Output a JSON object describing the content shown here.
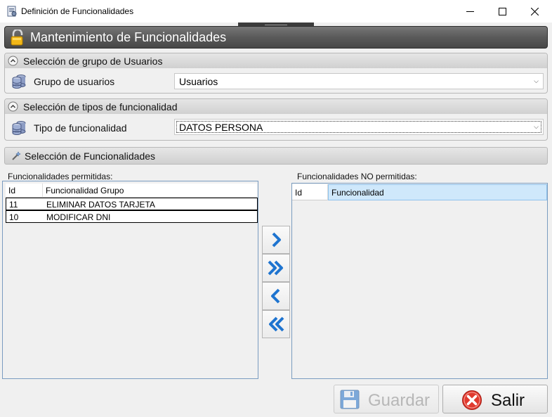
{
  "window": {
    "title": "Definición de Funcionalidades",
    "icon": "app-form-icon"
  },
  "header": {
    "title": "Mantenimiento de Funcionalidades",
    "icon": "lock-icon"
  },
  "group_users": {
    "title": "Selección de grupo de Usuarios",
    "label": "Grupo de usuarios",
    "selected": "Usuarios"
  },
  "group_types": {
    "title": "Selección de tipos de funcionalidad",
    "label": "Tipo de funcionalidad",
    "selected": "DATOS PERSONA"
  },
  "functionalities": {
    "title": "Selección de Funcionalidades",
    "permitted": {
      "label": "Funcionalidades permitidas:",
      "columns": [
        "Id",
        "Funcionalidad Grupo"
      ],
      "rows": [
        {
          "id": "11",
          "name": "ELIMINAR DATOS TARJETA"
        },
        {
          "id": "10",
          "name": "MODIFICAR DNI"
        }
      ]
    },
    "not_permitted": {
      "label": "Funcionalidades NO permitidas:",
      "columns": [
        "Id",
        "Funcionalidad"
      ],
      "rows": []
    }
  },
  "buttons": {
    "save": "Guardar",
    "exit": "Salir"
  },
  "colors": {
    "header_bg": "#5a5a5a",
    "accent_blue": "#1e74d0",
    "exit_red": "#e03a2f",
    "grid_border": "#7a9cc0"
  }
}
